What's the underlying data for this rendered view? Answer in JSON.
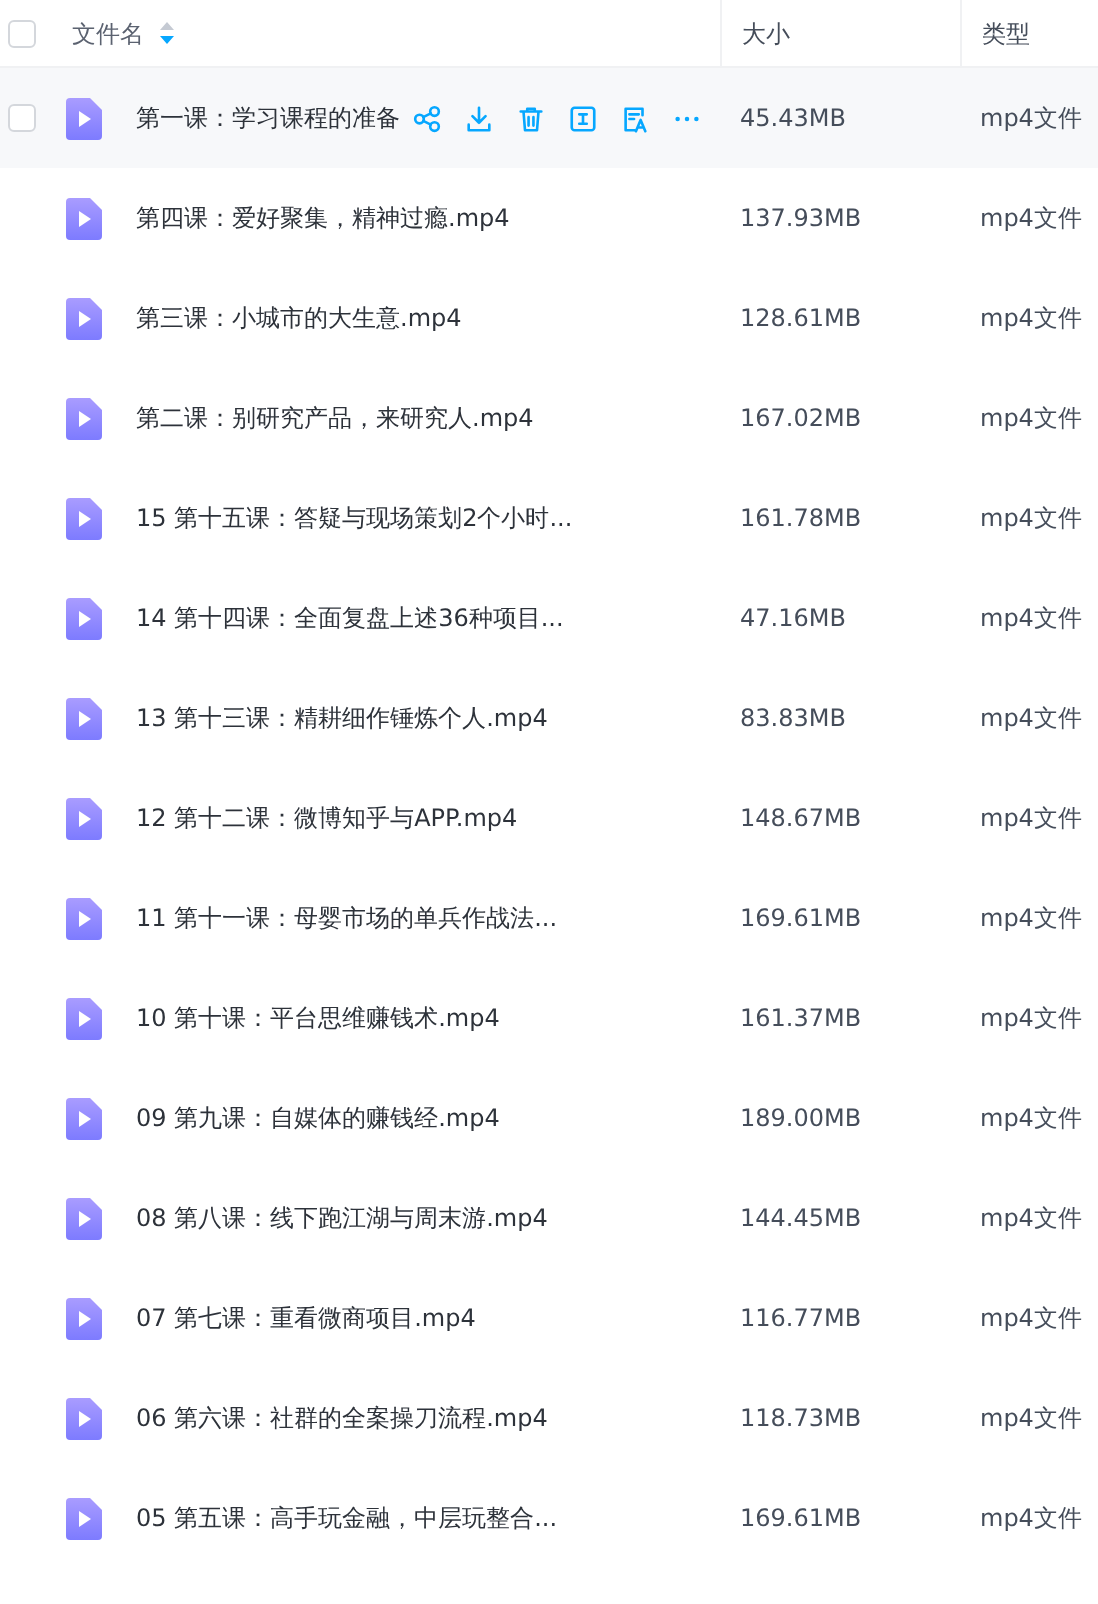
{
  "header": {
    "checkbox_checked": false,
    "columns": [
      {
        "label": "文件名",
        "sorted": true,
        "sort_descending": true
      },
      {
        "label": "大小"
      },
      {
        "label": "类型"
      }
    ]
  },
  "rows": [
    {
      "name": "第一课：学习课程的准备",
      "size": "45.43MB",
      "type": "mp4文件",
      "hovered": true,
      "checked": false
    },
    {
      "name": "第四课：爱好聚集，精神过瘾.mp4",
      "size": "137.93MB",
      "type": "mp4文件",
      "hovered": false,
      "checked": false
    },
    {
      "name": "第三课：小城市的大生意.mp4",
      "size": "128.61MB",
      "type": "mp4文件",
      "hovered": false,
      "checked": false
    },
    {
      "name": "第二课：别研究产品，来研究人.mp4",
      "size": "167.02MB",
      "type": "mp4文件",
      "hovered": false,
      "checked": false
    },
    {
      "name": "15 第十五课：答疑与现场策划2个小时...",
      "size": "161.78MB",
      "type": "mp4文件",
      "hovered": false,
      "checked": false
    },
    {
      "name": "14 第十四课：全面复盘上述36种项目...",
      "size": "47.16MB",
      "type": "mp4文件",
      "hovered": false,
      "checked": false
    },
    {
      "name": "13 第十三课：精耕细作锤炼个人.mp4",
      "size": "83.83MB",
      "type": "mp4文件",
      "hovered": false,
      "checked": false
    },
    {
      "name": "12 第十二课：微博知乎与APP.mp4",
      "size": "148.67MB",
      "type": "mp4文件",
      "hovered": false,
      "checked": false
    },
    {
      "name": "11 第十一课：母婴市场的单兵作战法...",
      "size": "169.61MB",
      "type": "mp4文件",
      "hovered": false,
      "checked": false
    },
    {
      "name": "10 第十课：平台思维赚钱术.mp4",
      "size": "161.37MB",
      "type": "mp4文件",
      "hovered": false,
      "checked": false
    },
    {
      "name": "09 第九课：自媒体的赚钱经.mp4",
      "size": "189.00MB",
      "type": "mp4文件",
      "hovered": false,
      "checked": false
    },
    {
      "name": "08 第八课：线下跑江湖与周末游.mp4",
      "size": "144.45MB",
      "type": "mp4文件",
      "hovered": false,
      "checked": false
    },
    {
      "name": "07 第七课：重看微商项目.mp4",
      "size": "116.77MB",
      "type": "mp4文件",
      "hovered": false,
      "checked": false
    },
    {
      "name": "06 第六课：社群的全案操刀流程.mp4",
      "size": "118.73MB",
      "type": "mp4文件",
      "hovered": false,
      "checked": false
    },
    {
      "name": "05 第五课：高手玩金融，中层玩整合...",
      "size": "169.61MB",
      "type": "mp4文件",
      "hovered": false,
      "checked": false
    }
  ]
}
